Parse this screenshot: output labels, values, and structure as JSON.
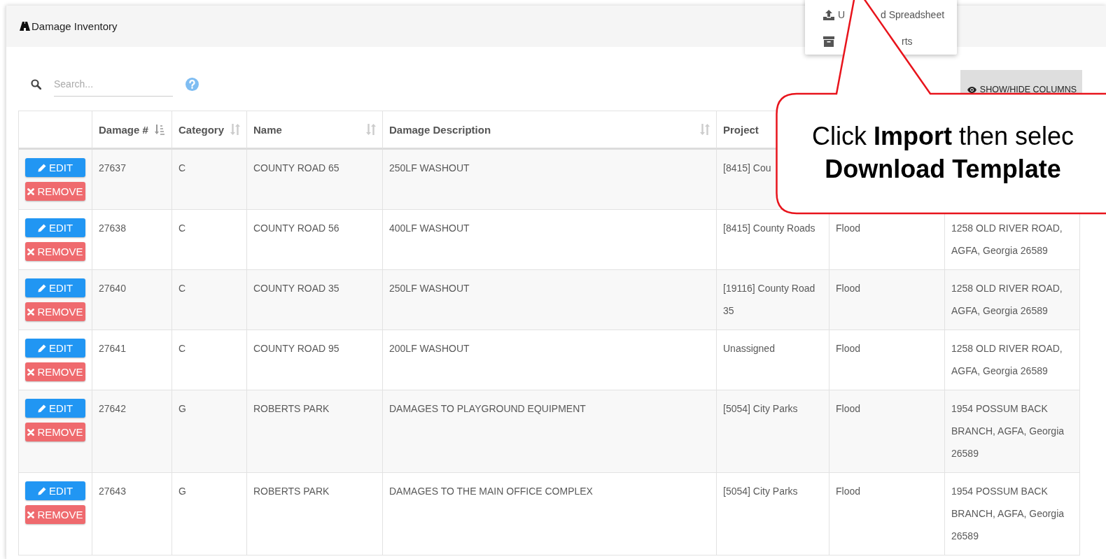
{
  "panel": {
    "title": "Damage Inventory"
  },
  "search": {
    "placeholder": "Search..."
  },
  "show_hide_button": {
    "label": "SHOW/HIDE COLUMNS"
  },
  "menu": {
    "items": [
      {
        "kind": "upload",
        "text_start": "U",
        "text_end": "d Spreadsheet"
      },
      {
        "kind": "archive",
        "text_end": "rts"
      }
    ]
  },
  "table": {
    "columns": [
      {
        "label": "Damage #",
        "sorted": true
      },
      {
        "label": "Category",
        "sorted": false
      },
      {
        "label": "Name",
        "sorted": false
      },
      {
        "label": "Damage Description",
        "sorted": false
      },
      {
        "label": "Project"
      }
    ],
    "rows": [
      {
        "actions": [
          {
            "kind": "edit",
            "label": "EDIT"
          },
          {
            "kind": "remove",
            "label": "REMOVE"
          }
        ],
        "cells": [
          "27637",
          "C",
          "COUNTY ROAD 65",
          "250LF WASHOUT",
          "[8415] Cou"
        ]
      },
      {
        "actions": [
          {
            "kind": "edit",
            "label": "EDIT"
          },
          {
            "kind": "remove",
            "label": "REMOVE"
          }
        ],
        "cells": [
          "27638",
          "C",
          "COUNTY ROAD 56",
          "400LF WASHOUT",
          "[8415] County Roads",
          "Flood",
          "1258 OLD RIVER ROAD, AGFA, Georgia 26589"
        ]
      },
      {
        "actions": [
          {
            "kind": "edit",
            "label": "EDIT"
          },
          {
            "kind": "remove",
            "label": "REMOVE"
          }
        ],
        "cells": [
          "27640",
          "C",
          "COUNTY ROAD 35",
          "250LF WASHOUT",
          "[19116] County Road 35",
          "Flood",
          "1258 OLD RIVER ROAD, AGFA, Georgia 26589"
        ]
      },
      {
        "actions": [
          {
            "kind": "edit",
            "label": "EDIT"
          },
          {
            "kind": "remove",
            "label": "REMOVE"
          }
        ],
        "cells": [
          "27641",
          "C",
          "COUNTY ROAD 95",
          "200LF WASHOUT",
          "Unassigned",
          "Flood",
          "1258 OLD RIVER ROAD, AGFA, Georgia 26589"
        ]
      },
      {
        "actions": [
          {
            "kind": "edit",
            "label": "EDIT"
          },
          {
            "kind": "remove",
            "label": "REMOVE"
          }
        ],
        "cells": [
          "27642",
          "G",
          "ROBERTS PARK",
          "DAMAGES TO PLAYGROUND EQUIPMENT",
          "[5054] City Parks",
          "Flood",
          "1954 POSSUM BACK BRANCH, AGFA, Georgia 26589"
        ]
      },
      {
        "actions": [
          {
            "kind": "edit",
            "label": "EDIT"
          },
          {
            "kind": "remove",
            "label": "REMOVE"
          }
        ],
        "cells": [
          "27643",
          "G",
          "ROBERTS PARK",
          "DAMAGES TO THE MAIN OFFICE COMPLEX",
          "[5054] City Parks",
          "Flood",
          "1954 POSSUM BACK BRANCH, AGFA, Georgia 26589"
        ]
      }
    ]
  },
  "callout": {
    "lines": [
      {
        "text": "Click **Import** then selec",
        "bold": false
      },
      {
        "text": "Download Template",
        "bold": true
      }
    ]
  }
}
